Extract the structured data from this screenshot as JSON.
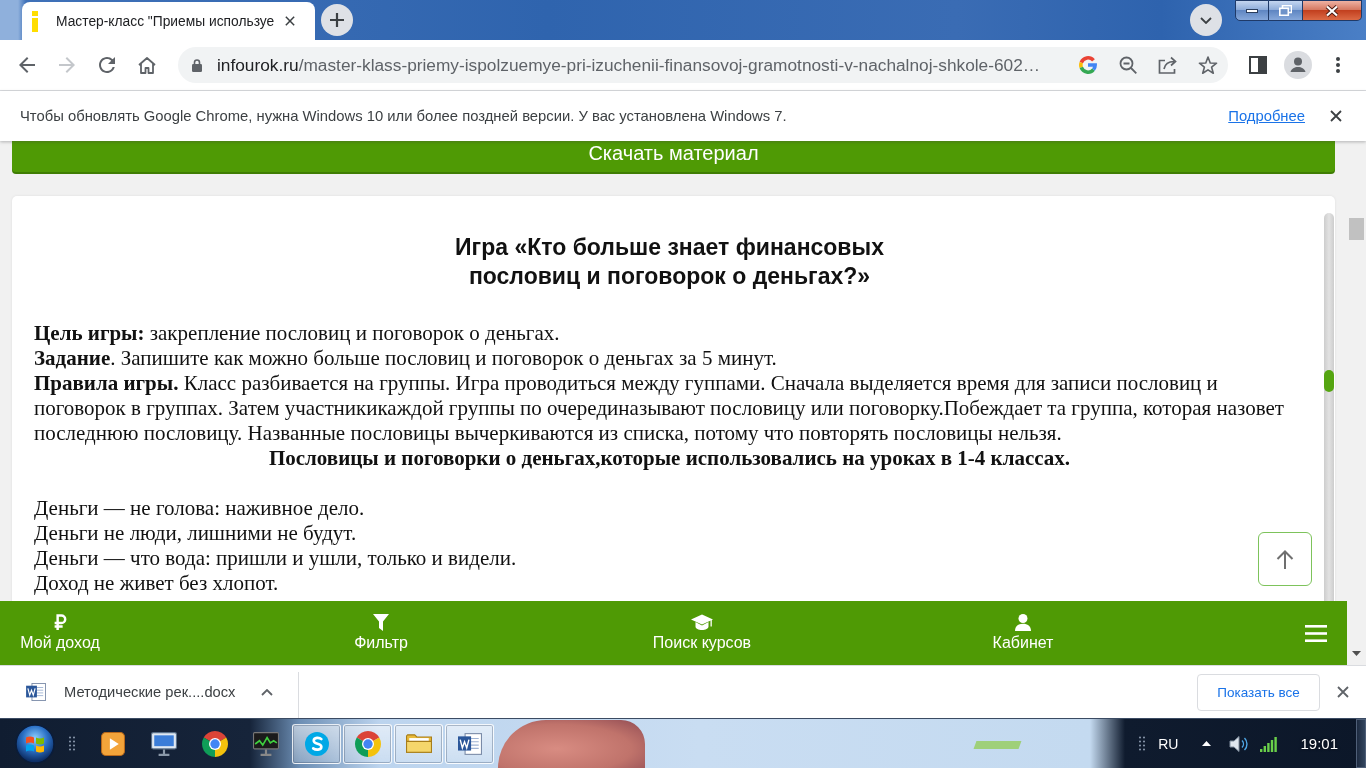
{
  "browser": {
    "tabs": [
      {
        "title": "Мастер-класс \"Приемы используе",
        "selected": true
      }
    ],
    "nav_buttons": [
      {
        "kind": "back",
        "disabled": false
      },
      {
        "kind": "forward",
        "disabled": true
      },
      {
        "kind": "reload",
        "disabled": false
      },
      {
        "kind": "home",
        "disabled": false
      }
    ],
    "address": {
      "domain": "infourok.ru",
      "path": "/master-klass-priemy-ispolzuemye-pri-izuchenii-finansovoj-gramotnosti-v-nachalnoj-shkole-602…"
    }
  },
  "infobar": {
    "message": "Чтобы обновлять Google Chrome, нужна Windows 10 или более поздней версии. У вас установлена Windows 7.",
    "link": "Подробнее"
  },
  "page": {
    "download_button": "Скачать материал",
    "article": {
      "title_lines": [
        "Игра «Кто больше знает финансовых",
        "пословиц и поговорок о деньгах?»"
      ],
      "blocks": [
        {
          "kind": "paragraph",
          "text": "**Цель игры:** закрепление пословиц и поговорок о деньгах."
        },
        {
          "kind": "paragraph",
          "text": "**Задание**. Запишите как можно больше пословиц и поговорок о деньгах за 5 минут."
        },
        {
          "kind": "paragraph",
          "text": "**Правила игры.** Класс разбивается на группы. Игра проводиться между гуппами. Сначала выделяется время для записи пословиц и поговорок в группах. Затем участникикаждой группы по очерединазывают пословицу или поговорку.Побеждает та группа, которая назовет последнюю пословицу. Названные пословицы вычеркиваются из списка, потому что повторять пословицы нельзя."
        },
        {
          "kind": "heading",
          "text": "Пословицы и поговорки о деньгах,которые использовались на уроках в 1-4 классах."
        }
      ],
      "proverbs": [
        "Деньги — не голова: наживное дело.",
        "Деньги не люди, лишними не будут.",
        "Деньги — что вода: пришли и ушли, только и видели.",
        "Доход не живет без хлопот."
      ]
    },
    "bottom_nav": [
      {
        "kind": "ruble",
        "label": "Мой доход"
      },
      {
        "kind": "filter",
        "label": "Фильтр"
      },
      {
        "kind": "courses",
        "label": "Поиск курсов"
      },
      {
        "kind": "account",
        "label": "Кабинет"
      }
    ]
  },
  "downloads": {
    "file": "Методические рек....docx",
    "show_all": "Показать все"
  },
  "taskbar": {
    "apps": [
      {
        "kind": "media-player",
        "open": false
      },
      {
        "kind": "network",
        "open": false
      },
      {
        "kind": "chrome",
        "open": false
      },
      {
        "kind": "monitor",
        "open": false
      },
      {
        "kind": "skype",
        "open": true
      },
      {
        "kind": "chrome",
        "open": true
      },
      {
        "kind": "explorer",
        "open": true
      },
      {
        "kind": "word",
        "open": true
      }
    ],
    "language": "RU",
    "clock": "19:01"
  }
}
